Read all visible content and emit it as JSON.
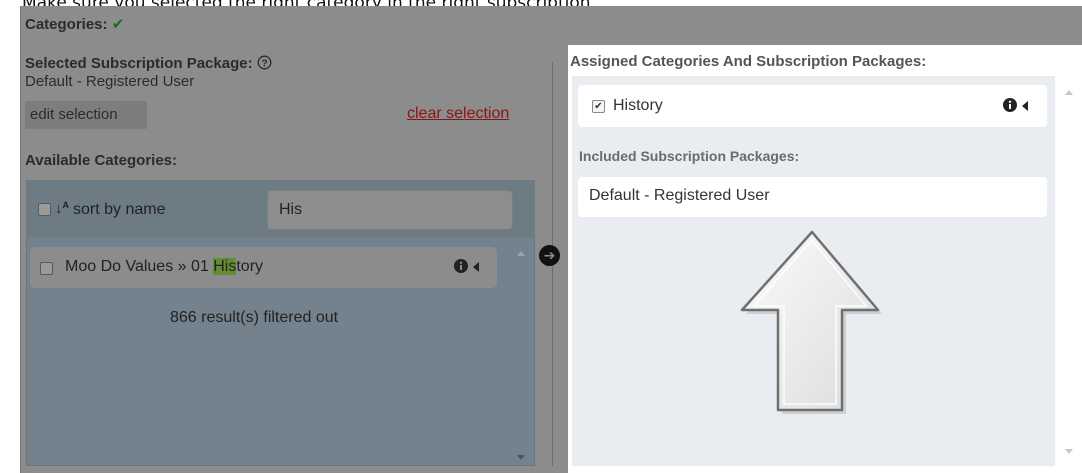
{
  "caption": "Make sure you selected the right category in the right subscription",
  "categories": {
    "label": "Categories:",
    "check_icon": "✔"
  },
  "subscription": {
    "label": "Selected Subscription Package:",
    "help_icon": "?",
    "value": "Default - Registered User",
    "edit_label": "edit selection",
    "clear_label": "clear selection"
  },
  "available": {
    "label": "Available Categories:",
    "sort_label": "sort by name",
    "search_value": "His",
    "result": {
      "prefix": "Moo Do Values » 01 ",
      "match": "His",
      "suffix": "tory"
    },
    "filtered_text": "866 result(s) filtered out"
  },
  "assigned": {
    "heading": "Assigned Categories And Subscription Packages:",
    "item_label": "History",
    "included_heading": "Included Subscription Packages:",
    "package_label": "Default - Registered User"
  },
  "colors": {
    "accent_green": "#628c35",
    "link_red": "#8b1515",
    "dim_overlay": "#8c8c8c"
  },
  "icons": [
    "check-icon",
    "help-icon",
    "sort-alpha-icon",
    "info-icon",
    "caret-left-icon",
    "arrow-right-circle-icon",
    "scroll-up-icon",
    "scroll-down-icon",
    "big-up-arrow-icon"
  ]
}
